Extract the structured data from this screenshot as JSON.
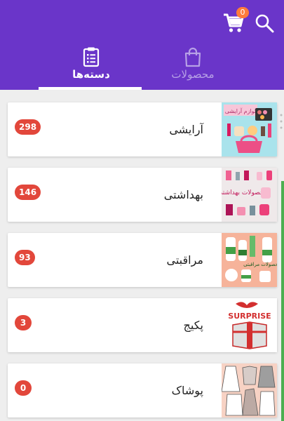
{
  "colors": {
    "header": "#6a35c9",
    "badge_count": "#e2473b",
    "badge_cart": "#ff7b3a",
    "scroll": "#4caf50"
  },
  "header": {
    "search_icon": "search-icon",
    "cart_icon": "cart-icon",
    "cart_count": "0"
  },
  "tabs": [
    {
      "label": "دسته‌ها",
      "icon": "clipboard-list-icon",
      "active": true
    },
    {
      "label": "محصولات",
      "icon": "shopping-bag-icon",
      "active": false
    }
  ],
  "categories": [
    {
      "name": "آرایشی",
      "count": "298",
      "thumb_text": "لوازم آرایشی"
    },
    {
      "name": "بهداشتی",
      "count": "146",
      "thumb_text": "محصولات بهداشتی"
    },
    {
      "name": "مراقبتی",
      "count": "93",
      "thumb_text": "محصولات مراقبتی"
    },
    {
      "name": "پکیج",
      "count": "3",
      "thumb_text": "SURPRISE"
    },
    {
      "name": "پوشاک",
      "count": "0",
      "thumb_text": ""
    }
  ]
}
